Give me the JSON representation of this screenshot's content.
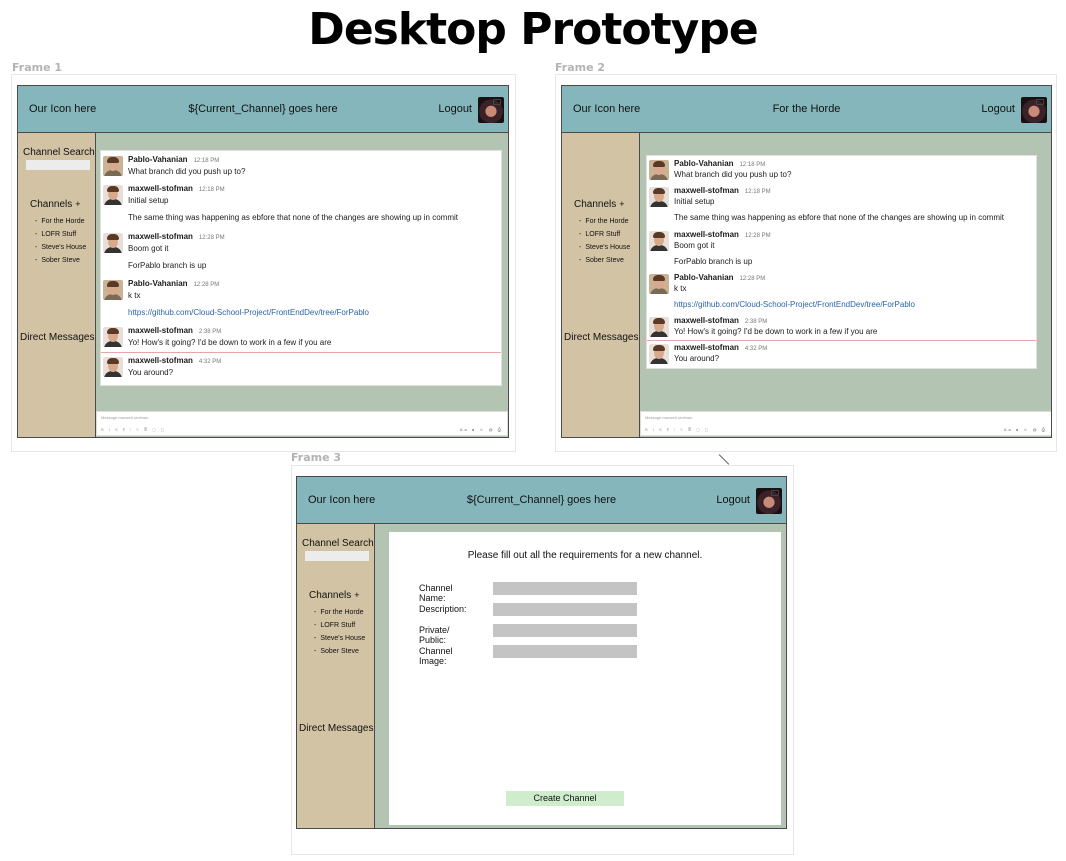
{
  "page_title": "Desktop Prototype",
  "frames": [
    {
      "label": "Frame 1",
      "header": {
        "icon_text": "Our Icon here",
        "channel": "${Current_Channel} goes here",
        "logout": "Logout"
      },
      "sidebar": {
        "search_label": "Channel Search",
        "channels_label": "Channels",
        "channels_add": "+",
        "channels": [
          "For the Horde",
          "LOFR Stuff",
          "Steve's House",
          "Sober Steve"
        ],
        "dm_label": "Direct Messages"
      },
      "messages": [
        {
          "name": "Pablo-Vahanian",
          "time": "12:18 PM",
          "lines": [
            "What branch did you push up to?"
          ]
        },
        {
          "name": "maxwell-stofman",
          "time": "12:18 PM",
          "lines": [
            "Initial setup",
            "The same thing was happening as ebfore that none of the changes are showing up in commit"
          ]
        },
        {
          "name": "maxwell-stofman",
          "time": "12:28 PM",
          "lines": [
            "Boom got it",
            "ForPablo branch is up"
          ]
        },
        {
          "name": "Pablo-Vahanian",
          "time": "12:28 PM",
          "lines": [
            "k tx",
            "https://github.com/Cloud-School-Project/FrontEndDev/tree/ForPablo"
          ]
        },
        {
          "name": "maxwell-stofman",
          "time": "2:38 PM",
          "lines": [
            "Yo! How's it going? I'd be down to work in a few if you are"
          ]
        },
        {
          "name": "maxwell-stofman",
          "time": "4:32 PM",
          "lines": [
            "You around?"
          ]
        }
      ],
      "composer_placeholder": "Message maxwell-stofman"
    },
    {
      "label": "Frame 2",
      "header": {
        "icon_text": "Our Icon here",
        "channel": "For the Horde",
        "logout": "Logout"
      },
      "sidebar": {
        "channels_label": "Channels",
        "channels_add": "+",
        "channels": [
          "For the Horde",
          "LOFR Stuff",
          "Steve's House",
          "Sober Steve"
        ],
        "dm_label": "Direct Messages"
      },
      "messages": [
        {
          "name": "Pablo-Vahanian",
          "time": "12:18 PM",
          "lines": [
            "What branch did you push up to?"
          ]
        },
        {
          "name": "maxwell-stofman",
          "time": "12:18 PM",
          "lines": [
            "Initial setup",
            "The same thing was happening as ebfore that none of the changes are showing up in commit"
          ]
        },
        {
          "name": "maxwell-stofman",
          "time": "12:28 PM",
          "lines": [
            "Boom got it",
            "ForPablo branch is up"
          ]
        },
        {
          "name": "Pablo-Vahanian",
          "time": "12:28 PM",
          "lines": [
            "k tx",
            "https://github.com/Cloud-School-Project/FrontEndDev/tree/ForPablo"
          ]
        },
        {
          "name": "maxwell-stofman",
          "time": "2:38 PM",
          "lines": [
            "Yo! How's it going? I'd be down to work in a few if you are"
          ]
        },
        {
          "name": "maxwell-stofman",
          "time": "4:32 PM",
          "lines": [
            "You around?"
          ]
        }
      ],
      "composer_placeholder": "Message maxwell-stofman"
    },
    {
      "label": "Frame 3",
      "header": {
        "icon_text": "Our Icon here",
        "channel": "${Current_Channel} goes here",
        "logout": "Logout"
      },
      "sidebar": {
        "search_label": "Channel Search",
        "channels_label": "Channels",
        "channels_add": "+",
        "channels": [
          "For the Horde",
          "LOFR Stuff",
          "Steve's House",
          "Sober Steve"
        ],
        "dm_label": "Direct Messages"
      },
      "form": {
        "intro": "Please fill out all the requirements for a new channel.",
        "fields": [
          "Channel Name:",
          "Description:",
          "Private/ Public:",
          "Channel Image:"
        ],
        "submit_label": "Create Channel"
      }
    }
  ],
  "colors": {
    "header": "#84b6bb",
    "sidebar": "#d2c3a5",
    "main": "#b3c5b2",
    "input": "#c4c4c4",
    "button": "#cfeccc",
    "link": "#2a64a8"
  }
}
